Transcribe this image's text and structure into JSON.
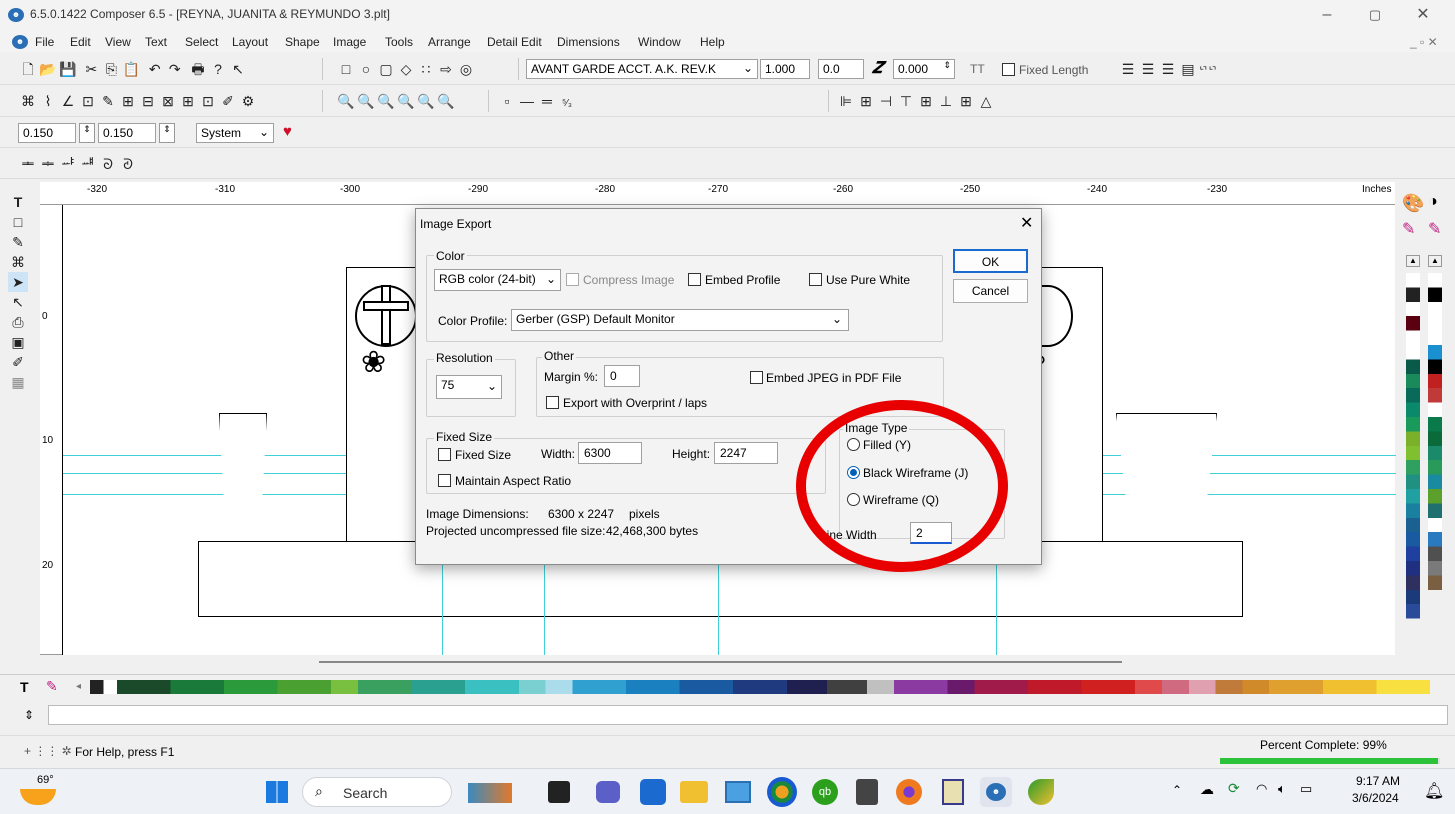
{
  "window": {
    "title": "6.5.0.1422 Composer 6.5 - [REYNA, JUANITA & REYMUNDO 3.plt]",
    "minimize_icon": "minimize-icon",
    "maximize_icon": "maximize-icon",
    "close_icon": "close-icon"
  },
  "menu": [
    "File",
    "Edit",
    "View",
    "Text",
    "Select",
    "Layout",
    "Shape",
    "Image",
    "Tools",
    "Arrange",
    "Detail Edit",
    "Dimensions",
    "Window",
    "Help"
  ],
  "toolbar": {
    "font_name": "AVANT GARDE ACCT. A.K. REV.K",
    "font_size": "1.000",
    "spacing": "0.0",
    "angle": "0.000",
    "fixed_length_label": "Fixed Length",
    "stroke_a": "0.150",
    "stroke_b": "0.150",
    "system_label": "System"
  },
  "ruler": {
    "ticks": [
      "-320",
      "-310",
      "-300",
      "-290",
      "-280",
      "-270",
      "-260",
      "-250",
      "-240",
      "-230"
    ],
    "units": "Inches",
    "v_ticks": [
      "0",
      "10",
      "20"
    ]
  },
  "dialog": {
    "title": "Image Export",
    "color_group": "Color",
    "color_mode": "RGB color (24-bit)",
    "compress_image": "Compress Image",
    "embed_profile": "Embed Profile",
    "use_pure_white": "Use Pure White",
    "color_profile_label": "Color Profile:",
    "color_profile_value": "Gerber (GSP) Default Monitor",
    "resolution_group": "Resolution",
    "resolution_value": "75",
    "other_group": "Other",
    "margin_label": "Margin %:",
    "margin_value": "0",
    "embed_jpeg": "Embed JPEG in PDF File",
    "export_overprint": "Export with Overprint / laps",
    "fixed_size_group": "Fixed Size",
    "fixed_size_label": "Fixed Size",
    "width_label": "Width:",
    "width_value": "6300",
    "height_label": "Height:",
    "height_value": "2247",
    "maintain_aspect": "Maintain Aspect Ratio",
    "image_dimensions_label": "Image Dimensions:",
    "image_dimensions_value": "6300 x 2247",
    "pixels_label": "pixels",
    "file_size_label": "Projected uncompressed file size:",
    "file_size_value": "42,468,300 bytes",
    "image_type_group": "Image Type",
    "filled": "Filled (Y)",
    "black_wireframe": "Black Wireframe (J)",
    "wireframe": "Wireframe (Q)",
    "line_width_label": "Line Width",
    "line_width_value": "2",
    "ok": "OK",
    "cancel": "Cancel"
  },
  "status": {
    "help_text": "For Help, press F1",
    "percent_label": "Percent Complete: 99%",
    "percent": 0.99
  },
  "taskbar": {
    "weather": "69°",
    "search_placeholder": "Search",
    "time": "9:17 AM",
    "date": "3/6/2024"
  }
}
